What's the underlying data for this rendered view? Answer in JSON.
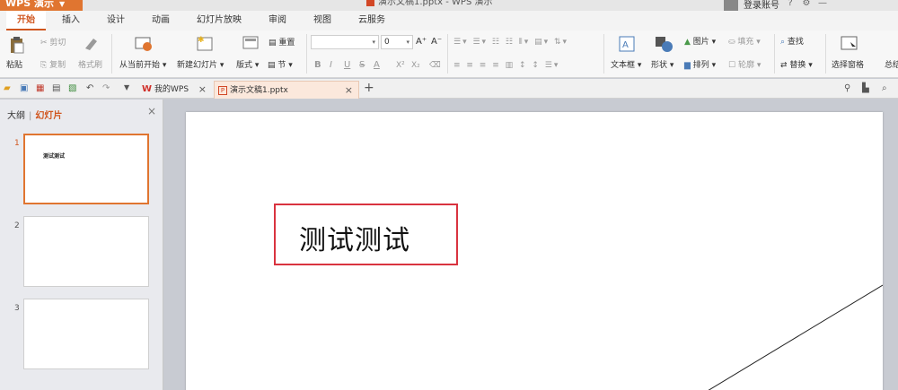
{
  "titlebar": {
    "app_menu": "WPS 演示",
    "doc_title": "演示文稿1.pptx - WPS 演示",
    "user": "登录账号"
  },
  "tabs": [
    "开始",
    "插入",
    "设计",
    "动画",
    "幻灯片放映",
    "审阅",
    "视图",
    "云服务"
  ],
  "ribbon": {
    "paste": "粘贴",
    "cut": "剪切",
    "copy": "复制",
    "format_painter": "格式刷",
    "from_current": "从当前开始",
    "new_slide": "新建幻灯片",
    "layout": "版式",
    "section": "节",
    "reset": "重置",
    "font_size": "0",
    "bold": "B",
    "italic": "I",
    "underline": "U",
    "strike": "S",
    "font_color": "A",
    "superscript": "X²",
    "subscript": "X₂",
    "text_box": "文本框",
    "shape": "形状",
    "picture": "图片",
    "fill": "填充",
    "arrange": "排列",
    "outline": "轮廓",
    "find": "查找",
    "replace": "替换",
    "select_pane": "选择窗格",
    "more": "总结"
  },
  "quickbar": {
    "tab_mywps": "我的WPS",
    "tab_doc": "演示文稿1.pptx"
  },
  "leftpanel": {
    "tab_outline": "大纲",
    "tab_slides": "幻灯片",
    "slides": [
      {
        "num": "1",
        "text": "测试测试"
      },
      {
        "num": "2",
        "text": ""
      },
      {
        "num": "3",
        "text": ""
      }
    ]
  },
  "slide": {
    "textbox_text": "测试测试"
  },
  "colors": {
    "accent": "#d0561f",
    "app_menu_bg": "#e07530",
    "textbox_border": "#d9333f"
  }
}
